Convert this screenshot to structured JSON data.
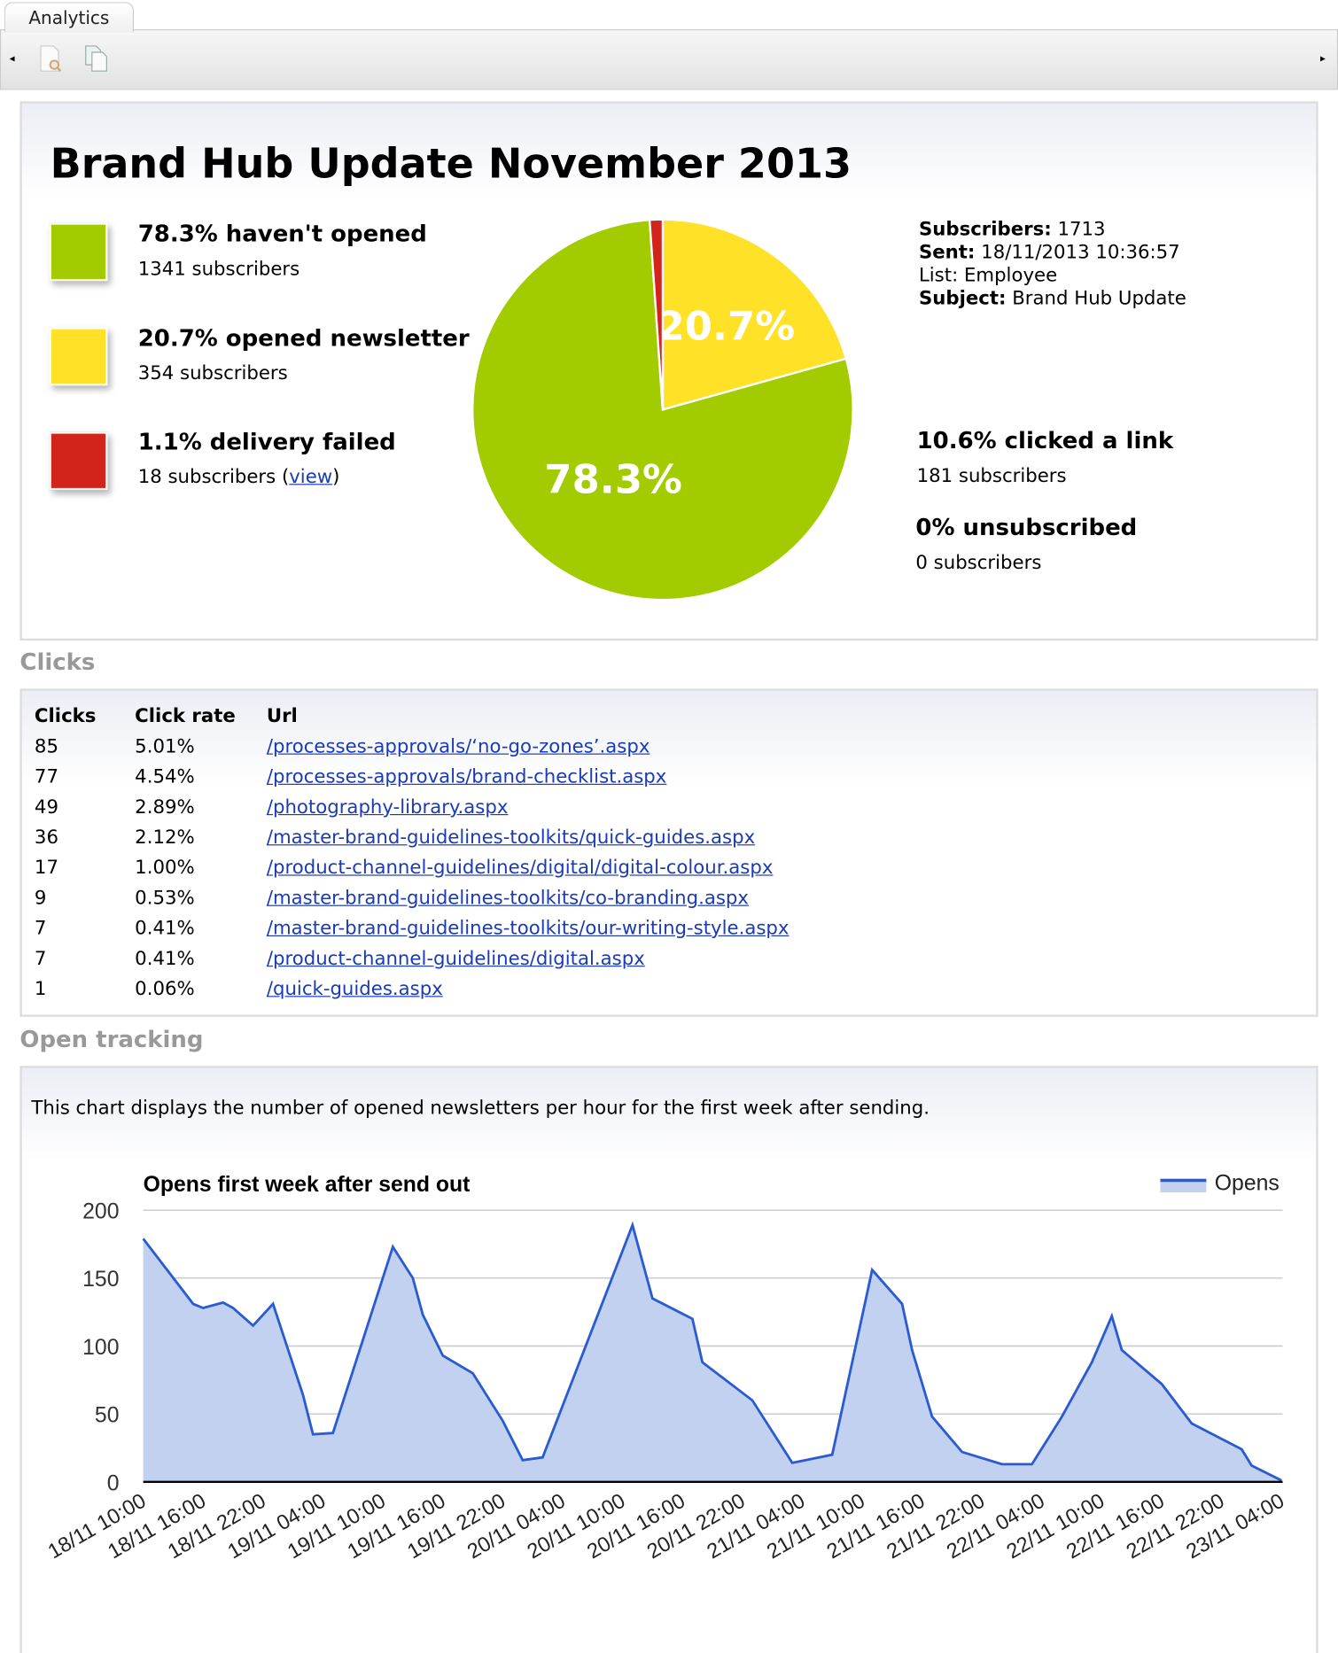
{
  "tab": {
    "label": "Analytics"
  },
  "toolbar": {
    "left_arrow": "◂",
    "right_arrow": "▸",
    "icons": [
      "document-search-icon",
      "copy-documents-icon"
    ]
  },
  "report": {
    "title": "Brand Hub Update November 2013",
    "legend": [
      {
        "title": "78.3% haven't opened",
        "sub": "1341 subscribers",
        "color": "#a2cb00"
      },
      {
        "title": "20.7% opened newsletter",
        "sub": "354 subscribers",
        "color": "#ffe227"
      },
      {
        "title": "1.1% delivery failed",
        "sub_prefix": "18 subscribers (",
        "link": "view",
        "sub_suffix": ")",
        "color": "#d3241c"
      }
    ],
    "pie": {
      "slices": [
        {
          "label": "20.7%",
          "value": 20.7,
          "color": "#ffe227"
        },
        {
          "label": "78.3%",
          "value": 78.3,
          "color": "#a2cb00"
        },
        {
          "label": "",
          "value": 1.1,
          "color": "#d3241c"
        }
      ]
    },
    "info": {
      "subscribers_label": "Subscribers:",
      "subscribers": "1713",
      "sent_label": "Sent:",
      "sent": "18/11/2013 10:36:57",
      "list": "List: Employee",
      "subject_label": "Subject:",
      "subject": "Brand Hub Update"
    },
    "clicked": {
      "title": "10.6% clicked a link",
      "sub": "181 subscribers"
    },
    "unsubscribed": {
      "title": "0% unsubscribed",
      "sub": "0 subscribers"
    }
  },
  "clicks": {
    "heading": "Clicks",
    "columns": [
      "Clicks",
      "Click rate",
      "Url"
    ],
    "rows": [
      [
        "85",
        "5.01%",
        "/processes-approvals/‘no-go-zones’.aspx"
      ],
      [
        "77",
        "4.54%",
        "/processes-approvals/brand-checklist.aspx"
      ],
      [
        "49",
        "2.89%",
        "/photography-library.aspx"
      ],
      [
        "36",
        "2.12%",
        "/master-brand-guidelines-toolkits/quick-guides.aspx"
      ],
      [
        "17",
        "1.00%",
        "/product-channel-guidelines/digital/digital-colour.aspx"
      ],
      [
        "9",
        "0.53%",
        "/master-brand-guidelines-toolkits/co-branding.aspx"
      ],
      [
        "7",
        "0.41%",
        "/master-brand-guidelines-toolkits/our-writing-style.aspx"
      ],
      [
        "7",
        "0.41%",
        "/product-channel-guidelines/digital.aspx"
      ],
      [
        "1",
        "0.06%",
        "/quick-guides.aspx"
      ]
    ]
  },
  "open_tracking": {
    "heading": "Open tracking",
    "description": "This chart displays the number of opened newsletters per hour for the first week after sending."
  },
  "chart_data": {
    "type": "area",
    "title": "Opens first week after send out",
    "legend": "top-right",
    "grid": true,
    "ylim": [
      0,
      200
    ],
    "yticks": [
      "0",
      "50",
      "100",
      "150",
      "200"
    ],
    "xticks": [
      "18/11 10:00",
      "18/11 16:00",
      "18/11 22:00",
      "19/11 04:00",
      "19/11 10:00",
      "19/11 16:00",
      "19/11 22:00",
      "20/11 04:00",
      "20/11 10:00",
      "20/11 16:00",
      "20/11 22:00",
      "21/11 04:00",
      "21/11 10:00",
      "21/11 16:00",
      "21/11 22:00",
      "22/11 04:00",
      "22/11 10:00",
      "22/11 16:00",
      "22/11 22:00",
      "23/11 04:00"
    ],
    "line_color": "#2a5bd0",
    "fill_color": "#c2d1f0",
    "series": [
      {
        "name": "Opens",
        "points": [
          [
            "18/11 10:00",
            179
          ],
          [
            "18/11 15:00",
            131
          ],
          [
            "18/11 16:00",
            128
          ],
          [
            "18/11 18:00",
            132
          ],
          [
            "18/11 19:00",
            128
          ],
          [
            "18/11 21:00",
            115
          ],
          [
            "18/11 23:00",
            131
          ],
          [
            "19/11 02:00",
            64
          ],
          [
            "19/11 03:00",
            35
          ],
          [
            "19/11 05:00",
            36
          ],
          [
            "19/11 11:00",
            173
          ],
          [
            "19/11 13:00",
            150
          ],
          [
            "19/11 14:00",
            123
          ],
          [
            "19/11 16:00",
            93
          ],
          [
            "19/11 19:00",
            80
          ],
          [
            "19/11 22:00",
            45
          ],
          [
            "20/11 00:00",
            16
          ],
          [
            "20/11 02:00",
            18
          ],
          [
            "20/11 11:00",
            189
          ],
          [
            "20/11 13:00",
            135
          ],
          [
            "20/11 17:00",
            120
          ],
          [
            "20/11 18:00",
            88
          ],
          [
            "20/11 23:00",
            60
          ],
          [
            "21/11 03:00",
            14
          ],
          [
            "21/11 07:00",
            20
          ],
          [
            "21/11 11:00",
            156
          ],
          [
            "21/11 14:00",
            131
          ],
          [
            "21/11 15:00",
            97
          ],
          [
            "21/11 17:00",
            48
          ],
          [
            "21/11 20:00",
            22
          ],
          [
            "22/11 00:00",
            13
          ],
          [
            "22/11 03:00",
            13
          ],
          [
            "22/11 06:00",
            48
          ],
          [
            "22/11 09:00",
            88
          ],
          [
            "22/11 11:00",
            122
          ],
          [
            "22/11 12:00",
            97
          ],
          [
            "22/11 16:00",
            72
          ],
          [
            "22/11 19:00",
            43
          ],
          [
            "23/11 00:00",
            24
          ],
          [
            "23/11 01:00",
            12
          ],
          [
            "23/11 04:00",
            1
          ]
        ]
      }
    ]
  }
}
